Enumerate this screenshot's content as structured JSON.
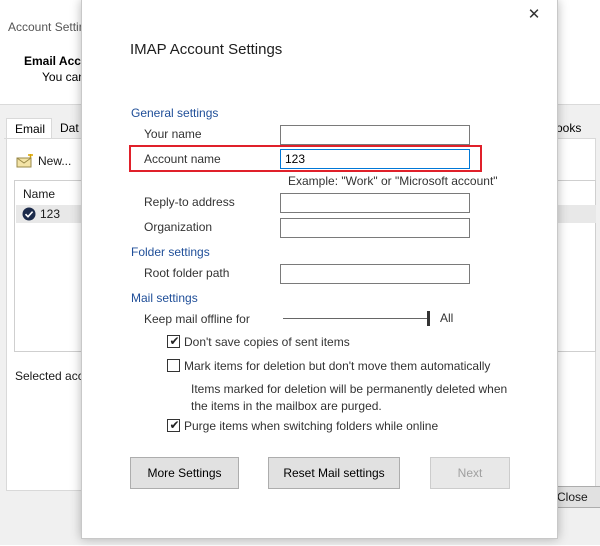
{
  "background": {
    "window_title": "Account Settin",
    "header_title": "Email Accou",
    "header_sub": "You can",
    "tabs": [
      "Email",
      "Dat",
      "ooks"
    ],
    "new_label": "New...",
    "list_header": "Name",
    "account_row": "123",
    "selected_label": "Selected acco",
    "close_label": "Close"
  },
  "dialog": {
    "title": "IMAP Account Settings",
    "close_glyph": "✕",
    "sections": {
      "general": "General settings",
      "folder": "Folder settings",
      "mail": "Mail settings"
    },
    "fields": {
      "your_name": {
        "label": "Your name",
        "value": ""
      },
      "account_name": {
        "label": "Account name",
        "value": "123"
      },
      "account_example": "Example: \"Work\" or \"Microsoft account\"",
      "reply_to": {
        "label": "Reply-to address",
        "value": ""
      },
      "organization": {
        "label": "Organization",
        "value": ""
      },
      "root_folder": {
        "label": "Root folder path",
        "value": ""
      }
    },
    "mail": {
      "offline_label": "Keep mail offline for",
      "offline_value": "All",
      "offline_level": 1.0,
      "no_sent_copies": {
        "label": "Don't save copies of sent items",
        "checked": true
      },
      "mark_deletion": {
        "label": "Mark items for deletion but don't move them automatically",
        "checked": false
      },
      "deletion_note_line1": "Items marked for deletion will be permanently deleted when",
      "deletion_note_line2": "the items in the mailbox are purged.",
      "purge": {
        "label": "Purge items when switching folders while online",
        "checked": true
      }
    },
    "buttons": {
      "more_settings": "More Settings",
      "reset_mail": "Reset Mail settings",
      "next": "Next"
    }
  },
  "colors": {
    "section_blue": "#1f4e98",
    "highlight_red": "#e0202a",
    "focus_blue": "#0078d7"
  }
}
